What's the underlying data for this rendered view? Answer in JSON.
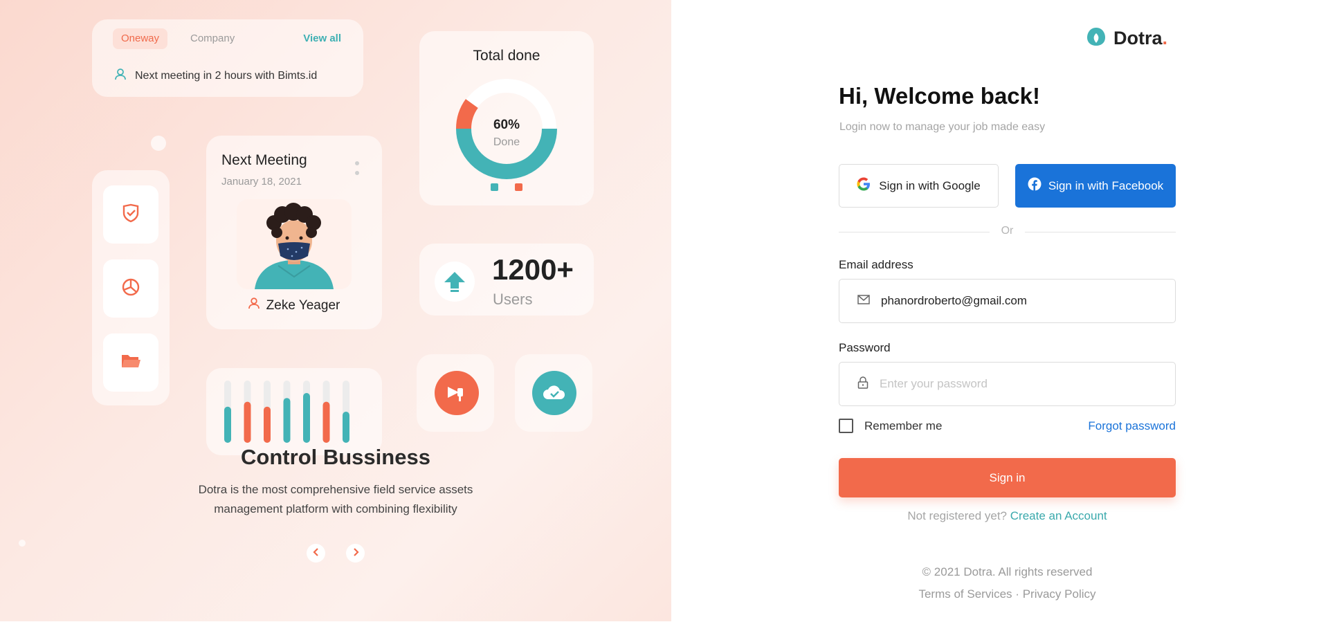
{
  "colors": {
    "accent": "#f26a4b",
    "teal": "#43b3b6",
    "facebook": "#1a73d9"
  },
  "promo": {
    "tabs": [
      "Oneway",
      "Company"
    ],
    "view_all": "View all",
    "meeting_notice": "Next meeting in 2 hours with Bimts.id",
    "total_done": {
      "title": "Total done",
      "percent_label": "60%",
      "caption": "Done",
      "percent": 60
    },
    "users": {
      "count": "1200+",
      "label": "Users"
    },
    "next_meeting": {
      "title": "Next Meeting",
      "date": "January 18, 2021",
      "person": "Zeke Yeager"
    },
    "bars": [
      {
        "level": 0.58,
        "color": "teal"
      },
      {
        "level": 0.66,
        "color": "orange"
      },
      {
        "level": 0.58,
        "color": "orange"
      },
      {
        "level": 0.72,
        "color": "teal"
      },
      {
        "level": 0.8,
        "color": "teal"
      },
      {
        "level": 0.66,
        "color": "orange"
      },
      {
        "level": 0.5,
        "color": "teal"
      }
    ],
    "headline": "Control Bussiness",
    "description_line1": "Dotra is the most comprehensive field service assets",
    "description_line2": "management platform with combining flexibility",
    "side_icons": [
      "shield-check-icon",
      "pie-chart-icon",
      "folder-icon"
    ],
    "action_icons": [
      "megaphone-icon",
      "cloud-check-icon"
    ]
  },
  "login": {
    "brand": "Dotra",
    "brand_dot": ".",
    "title": "Hi, Welcome back!",
    "subtitle": "Login now to manage your job made easy",
    "google_label": "Sign in with Google",
    "facebook_label": "Sign in with Facebook",
    "or_label": "Or",
    "email_label": "Email address",
    "email_value": "phanordroberto@gmail.com",
    "password_label": "Password",
    "password_placeholder": "Enter your password",
    "remember_label": "Remember me",
    "forgot_label": "Forgot password",
    "signin_label": "Sign in",
    "register_prompt": "Not registered yet?",
    "register_link": "Create an Account",
    "copyright": "© 2021 Dotra. All rights reserved",
    "terms": "Terms of Services",
    "separator": "·",
    "privacy": "Privacy Policy"
  }
}
